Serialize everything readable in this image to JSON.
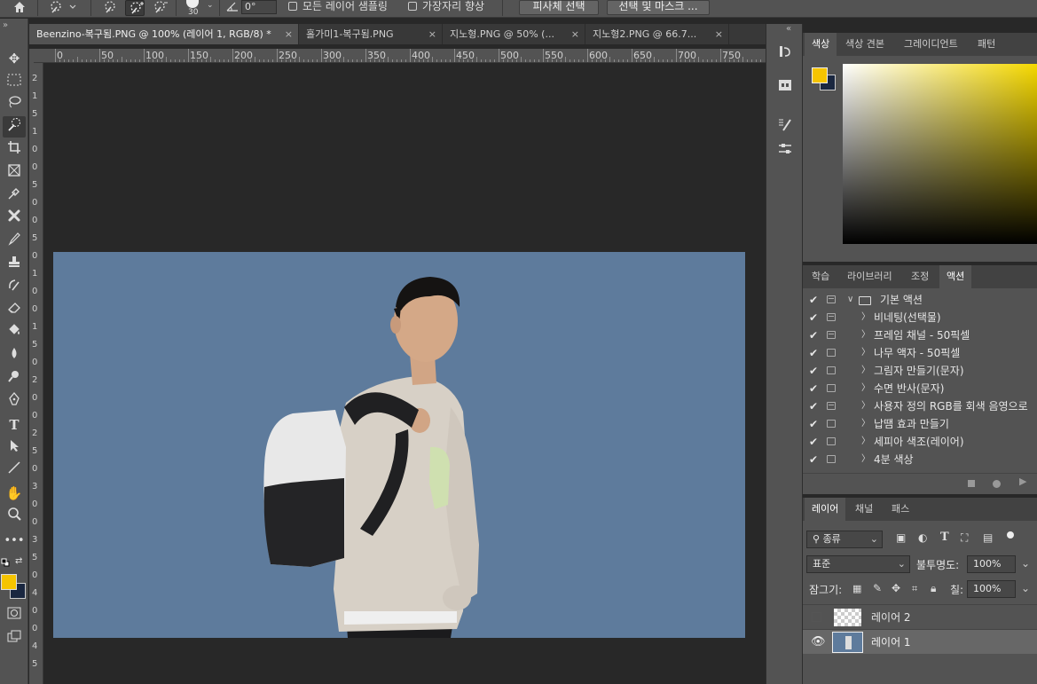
{
  "options_bar": {
    "brush_size": "30",
    "angle_value": "0°",
    "sample_all_layers_label": "모든 레이어 샘플링",
    "enhance_edge_label": "가장자리 향상",
    "select_subject_label": "피사체 선택",
    "select_mask_label": "선택 및 마스크 ..."
  },
  "tabs": [
    {
      "label": "Beenzino-복구됨.PNG @ 100% (레이어 1, RGB/8) *",
      "close": "×"
    },
    {
      "label": "홀가미1-복구됨.PNG",
      "close": "×"
    },
    {
      "label": "지노형.PNG @ 50% (...",
      "close": "×"
    },
    {
      "label": "지노형2.PNG @ 66.7...",
      "close": "×"
    }
  ],
  "ruler_top": [
    "0",
    "50",
    "100",
    "150",
    "200",
    "250",
    "300",
    "350",
    "400",
    "450",
    "500",
    "550",
    "600",
    "650",
    "700",
    "750"
  ],
  "ruler_left": [
    "2",
    "1",
    "5",
    "1",
    "0",
    "0",
    "5",
    "0",
    "0",
    "5",
    "0",
    "1",
    "0",
    "0",
    "1",
    "5",
    "0",
    "2",
    "0",
    "0",
    "2",
    "5",
    "0",
    "3",
    "0",
    "0",
    "3",
    "5",
    "0",
    "4",
    "0",
    "0",
    "4",
    "5"
  ],
  "color_panel": {
    "tabs": [
      "색상",
      "색상 견본",
      "그레이디언트",
      "패턴"
    ],
    "foreground": "#f5c400",
    "background": "#1a2740"
  },
  "actions_panel": {
    "tabs": [
      "학습",
      "라이브러리",
      "조정",
      "액션"
    ],
    "set_name": "기본 액션",
    "items": [
      {
        "label": "비네팅(선택물)",
        "dialog": true
      },
      {
        "label": "프레임 채널 - 50픽셀",
        "dialog": true
      },
      {
        "label": "나무 액자 - 50픽셀",
        "dialog": false
      },
      {
        "label": "그림자 만들기(문자)",
        "dialog": false
      },
      {
        "label": "수면 반사(문자)",
        "dialog": false
      },
      {
        "label": "사용자 정의 RGB를 회색 음영으로",
        "dialog": true
      },
      {
        "label": "납땜 효과 만들기",
        "dialog": false
      },
      {
        "label": "세피아 색조(레이어)",
        "dialog": false
      },
      {
        "label": "4분 색상",
        "dialog": false
      }
    ]
  },
  "layers_panel": {
    "tabs": [
      "레이어",
      "채널",
      "패스"
    ],
    "filter_kind": "종류",
    "blend_mode": "표준",
    "opacity_label": "불투명도:",
    "opacity_value": "100%",
    "lock_label": "잠그기:",
    "fill_label": "칠:",
    "fill_value": "100%",
    "layers": [
      {
        "name": "레이어 2",
        "visible": false
      },
      {
        "name": "레이어 1",
        "visible": true
      }
    ]
  }
}
